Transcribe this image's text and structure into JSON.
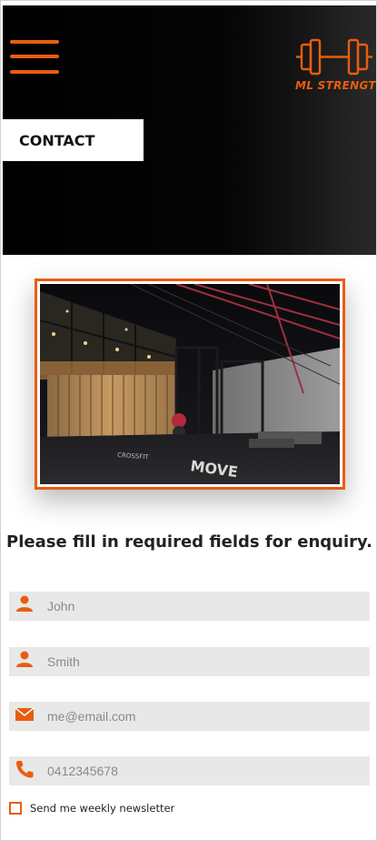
{
  "header": {
    "menu_icon": "hamburger-menu-icon",
    "logo_icon": "dumbbell-icon",
    "logo_text": "ML STRENGTH",
    "page_label": "CONTACT"
  },
  "hero": {
    "image": "gym-interior-photo"
  },
  "form": {
    "title": "Please fill in required fields for enquiry.",
    "fields": [
      {
        "icon": "person-icon",
        "placeholder": "John",
        "value": ""
      },
      {
        "icon": "person-icon",
        "placeholder": "Smith",
        "value": ""
      },
      {
        "icon": "envelope-icon",
        "placeholder": "me@email.com",
        "value": ""
      },
      {
        "icon": "phone-icon",
        "placeholder": "0412345678",
        "value": ""
      }
    ],
    "newsletter_label": "Send me weekly newsletter",
    "newsletter_checked": false
  },
  "colors": {
    "accent": "#e85d0f",
    "header_bg": "#000000",
    "field_bg": "#e8e8e8",
    "text": "#222222"
  }
}
